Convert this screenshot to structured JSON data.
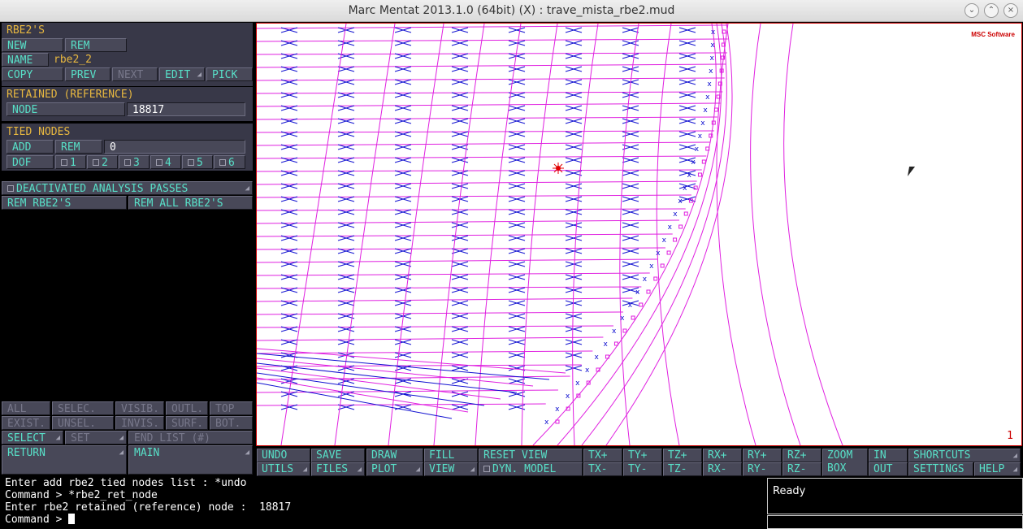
{
  "window": {
    "title": "Marc Mentat 2013.1.0 (64bit) (X) : trave_mista_rbe2.mud"
  },
  "rbe2": {
    "header": "RBE2'S",
    "new": "NEW",
    "rem": "REM",
    "name_label": "NAME",
    "name_value": "rbe2_2",
    "copy": "COPY",
    "prev": "PREV",
    "next": "NEXT",
    "edit": "EDIT",
    "pick": "PICK"
  },
  "retained": {
    "header": "RETAINED (REFERENCE)",
    "node_label": "NODE",
    "node_value": "18817"
  },
  "tied": {
    "header": "TIED NODES",
    "add": "ADD",
    "rem": "REM",
    "count": "0",
    "dof_label": "DOF",
    "dofs": [
      "1",
      "2",
      "3",
      "4",
      "5",
      "6"
    ]
  },
  "deactivated": "DEACTIVATED ANALYSIS PASSES",
  "rem_rbe2s": "REM RBE2'S",
  "rem_all_rbe2s": "REM ALL RBE2'S",
  "select_grid": {
    "row1": [
      "ALL",
      "SELEC.",
      "VISIB.",
      "OUTL.",
      "TOP"
    ],
    "row2": [
      "EXIST.",
      "UNSEL.",
      "INVIS.",
      "SURF.",
      "BOT."
    ],
    "select": "SELECT",
    "set": "SET",
    "end_list": "END LIST (#)"
  },
  "nav": {
    "return": "RETURN",
    "main": "MAIN"
  },
  "viewport": {
    "logo": "MSC Software",
    "number": "1"
  },
  "toolbar": {
    "undo": "UNDO",
    "save": "SAVE",
    "draw": "DRAW",
    "fill": "FILL",
    "reset_view": "RESET VIEW",
    "txp": "TX+",
    "typ": "TY+",
    "tzp": "TZ+",
    "rxp": "RX+",
    "ryp": "RY+",
    "rzp": "RZ+",
    "zoom": "ZOOM",
    "box": "BOX",
    "in": "IN",
    "shortcuts": "SHORTCUTS",
    "utils": "UTILS",
    "files": "FILES",
    "plot": "PLOT",
    "view": "VIEW",
    "dyn_model": "DYN. MODEL",
    "txm": "TX-",
    "tym": "TY-",
    "tzm": "TZ-",
    "rxm": "RX-",
    "rym": "RY-",
    "rzm": "RZ-",
    "out": "OUT",
    "settings": "SETTINGS",
    "help": "HELP"
  },
  "console": {
    "lines": [
      "Enter add rbe2 tied nodes list : *undo",
      "Command > *rbe2_ret_node",
      "Enter rbe2 retained (reference) node :  18817",
      "Command > "
    ]
  },
  "status": {
    "text": "Ready"
  },
  "colors": {
    "mesh": "#e020e0",
    "elements": "#1010d0",
    "accent_cyan": "#58e0c8",
    "accent_yellow": "#e8b840"
  }
}
